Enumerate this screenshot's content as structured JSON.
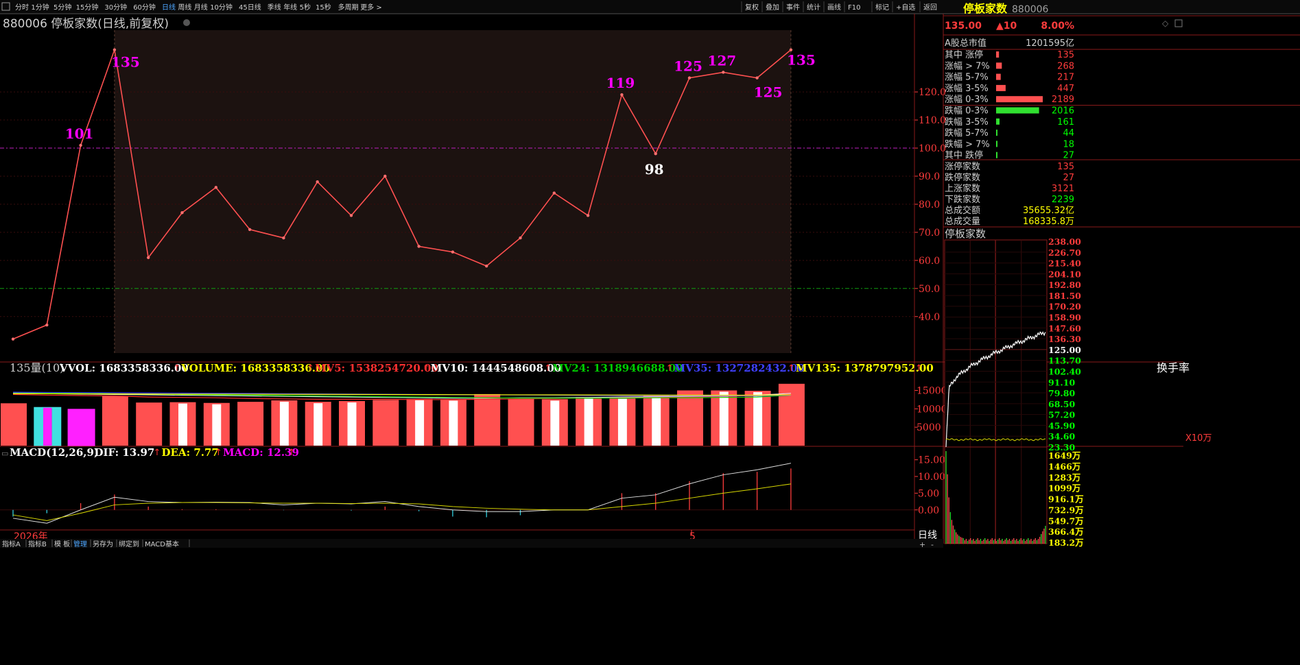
{
  "toolbar": {
    "periods": [
      "分时",
      "1分钟",
      "5分钟",
      "15分钟",
      "30分钟",
      "60分钟",
      "日线",
      "周线",
      "月线",
      "10分钟",
      "45日线",
      "季线",
      "年线",
      "5秒",
      "15秒",
      "多周期",
      "更多 >"
    ],
    "active_period": "日线",
    "right_buttons": [
      "复权",
      "叠加",
      "事件",
      "统计",
      "画线",
      "F10",
      "标记",
      "+自选",
      "返回"
    ]
  },
  "main_chart": {
    "title": "880006 停板家数(日线,前复权)",
    "y_ticks": [
      "120.0",
      "110.0",
      "100.0",
      "90.0",
      "80.0",
      "70.0",
      "60.0",
      "50.0",
      "40.0"
    ]
  },
  "chart_data": [
    {
      "type": "line",
      "name": "main",
      "values": [
        32,
        37,
        101,
        135,
        61,
        77,
        86,
        71,
        68,
        88,
        76,
        90,
        65,
        63,
        58,
        68,
        84,
        76,
        119,
        98,
        125,
        127,
        125,
        135
      ],
      "point_labels": [
        {
          "index": 2,
          "text": "101",
          "color": "#ff00ff"
        },
        {
          "index": 3,
          "text": "135",
          "color": "#ff00ff"
        },
        {
          "index": 18,
          "text": "119",
          "color": "#ff00ff"
        },
        {
          "index": 19,
          "text": "98",
          "color": "#ffffff"
        },
        {
          "index": 20,
          "text": "125",
          "color": "#ff00ff"
        },
        {
          "index": 21,
          "text": "127",
          "color": "#ff00ff"
        },
        {
          "index": 22,
          "text": "125",
          "color": "#ff00ff"
        },
        {
          "index": 23,
          "text": "135",
          "color": "#ff00ff"
        }
      ],
      "ylim": [
        27,
        142
      ],
      "ref_lines": [
        100,
        50
      ],
      "highlight_range": [
        3,
        23
      ],
      "line_color": "#ff5050"
    },
    {
      "type": "bar",
      "name": "volume",
      "values": [
        11500,
        10300,
        9800,
        13500,
        11700,
        11800,
        11600,
        11900,
        12300,
        11900,
        12100,
        12400,
        12700,
        12600,
        14000,
        12800,
        12600,
        13200,
        13100,
        13500,
        15000,
        15000,
        14900,
        16800
      ],
      "bar_styles": [
        "solid",
        "cyan",
        "magenta",
        "solid",
        "solid",
        "hollow",
        "hollow",
        "solid",
        "hollow",
        "hollow",
        "hollow",
        "solid",
        "hollow",
        "hollow",
        "solid",
        "solid",
        "hollow",
        "hollow",
        "hollow",
        "hollow",
        "solid",
        "hollow",
        "hollow",
        "solid"
      ],
      "ylim": [
        0,
        19000
      ],
      "y_ticks": [
        "15000",
        "10000",
        "5000"
      ],
      "unit": "X10万",
      "ma_series": [
        {
          "name": "MV5",
          "color": "#ff3030",
          "values": [
            13900,
            13700,
            13600,
            13500,
            13200,
            13100,
            13000,
            12800,
            12700,
            12600,
            12600,
            12600,
            12500,
            12500,
            12600,
            12700,
            12800,
            12900,
            13000,
            13100,
            13200,
            13400,
            13600,
            14000
          ]
        },
        {
          "name": "MV10",
          "color": "#e8e8e8",
          "values": [
            14200,
            14100,
            14000,
            13900,
            13800,
            13700,
            13600,
            13500,
            13400,
            13300,
            13200,
            13100,
            13000,
            12900,
            12900,
            13000,
            13000,
            13100,
            13200,
            13300,
            13400,
            13500,
            13700,
            14200
          ]
        },
        {
          "name": "MV24",
          "color": "#00cc00",
          "values": [
            14400,
            14300,
            14200,
            14100,
            14000,
            13900,
            13800,
            13700,
            13600,
            13500,
            13400,
            13300,
            13200,
            13100,
            13000,
            12900,
            12900,
            12900,
            12900,
            13000,
            13000,
            13100,
            13200,
            13700
          ]
        },
        {
          "name": "MV35",
          "color": "#4040ff",
          "values": [
            14500,
            14450,
            14400,
            14350,
            14300,
            14250,
            14200,
            14150,
            14100,
            14050,
            14000,
            13950,
            13900,
            13850,
            13800,
            13750,
            13700,
            13650,
            13600,
            13600,
            13600,
            13600,
            13600,
            13700
          ]
        },
        {
          "name": "MV135",
          "color": "#ffff00",
          "values": [
            14100,
            14080,
            14060,
            14040,
            14020,
            14000,
            13980,
            13960,
            13940,
            13920,
            13900,
            13880,
            13860,
            13840,
            13820,
            13800,
            13780,
            13760,
            13740,
            13720,
            13700,
            13700,
            13700,
            13800
          ]
        }
      ]
    },
    {
      "type": "line",
      "name": "macd",
      "dif": [
        -2.5,
        -4,
        0,
        3.8,
        2.5,
        2.2,
        2.3,
        2.2,
        1.5,
        2.0,
        1.8,
        2.5,
        1.0,
        0.0,
        -0.5,
        -0.5,
        0,
        0,
        3.5,
        4.5,
        7.8,
        10.5,
        12.0,
        13.97
      ],
      "dea": [
        -1.5,
        -3.2,
        -1.0,
        1.5,
        2.0,
        2.2,
        2.2,
        2.1,
        2.0,
        2.0,
        1.9,
        2.0,
        1.8,
        1.0,
        0.5,
        0.2,
        0,
        0,
        1.0,
        2.0,
        3.5,
        5.0,
        6.3,
        7.77
      ],
      "macd_bars": [
        -2.0,
        -1.0,
        2.0,
        4.6,
        1.0,
        0.2,
        0.2,
        0.2,
        -0.1,
        0,
        -0.2,
        1.0,
        -0.4,
        -2.0,
        -2.2,
        -1.6,
        0,
        0,
        5.0,
        5.0,
        8.6,
        11.0,
        11.4,
        12.39
      ],
      "ylim": [
        -6,
        18
      ],
      "y_ticks": [
        "15.00",
        "10.00",
        "5.00",
        "0.00"
      ]
    }
  ],
  "volume_panel": {
    "header": "135量(10)",
    "labels": [
      {
        "text": "VVOL: 1683358336.00",
        "color": "#ffffff"
      },
      {
        "text": "VOLUME: 1683358336.00",
        "color": "#ffff00"
      },
      {
        "text": "MV5: 1538254720.00",
        "color": "#ff3030"
      },
      {
        "text": "MV10: 1444548608.00",
        "color": "#ffffff"
      },
      {
        "text": "MV24: 1318946688.00",
        "color": "#00cc00"
      },
      {
        "text": "MV35: 1327282432.00",
        "color": "#4040ff"
      },
      {
        "text": "MV135: 1378797952.00",
        "color": "#ffff00"
      }
    ],
    "trailing": "换手率"
  },
  "macd_panel": {
    "labels": [
      {
        "text": "MACD(12,26,9)",
        "color": "#ffffff"
      },
      {
        "text": "DIF: 13.97",
        "color": "#ffffff"
      },
      {
        "text": "DEA: 7.77",
        "color": "#ffff00"
      },
      {
        "text": "MACD: 12.39",
        "color": "#ff00ff"
      }
    ]
  },
  "bottom_axis": {
    "year_label": "2026年",
    "month_label": "5",
    "period": "日线"
  },
  "bottom_tabs": [
    "指标A",
    "指标B",
    "模 板",
    "管理",
    "另存为",
    "绑定到",
    "MACD基本"
  ],
  "active_tab": "管理",
  "side_panel": {
    "title": "停板家数",
    "code": "880006",
    "price": "135.00",
    "change": "▲10",
    "change_pct": "8.00%",
    "market_cap_label": "A股总市值",
    "market_cap_value": "1201595亿",
    "dist_rows": [
      {
        "label": "其中 涨停",
        "value": "135",
        "kind": "up",
        "bar": 135
      },
      {
        "label": "涨幅 > 7%",
        "value": "268",
        "kind": "up",
        "bar": 268
      },
      {
        "label": "涨幅 5-7%",
        "value": "217",
        "kind": "up",
        "bar": 217
      },
      {
        "label": "涨幅 3-5%",
        "value": "447",
        "kind": "up",
        "bar": 447
      },
      {
        "label": "涨幅 0-3%",
        "value": "2189",
        "kind": "up",
        "bar": 2189
      },
      {
        "label": "跌幅 0-3%",
        "value": "2016",
        "kind": "down",
        "bar": 2016
      },
      {
        "label": "跌幅 3-5%",
        "value": "161",
        "kind": "down",
        "bar": 161
      },
      {
        "label": "跌幅 5-7%",
        "value": "44",
        "kind": "down",
        "bar": 44
      },
      {
        "label": "跌幅 > 7%",
        "value": "18",
        "kind": "down",
        "bar": 18
      },
      {
        "label": "其中 跌停",
        "value": "27",
        "kind": "down",
        "bar": 27
      }
    ],
    "stats_rows": [
      {
        "label": "涨停家数",
        "value": "135",
        "color": "#ff3c3c"
      },
      {
        "label": "跌停家数",
        "value": "27",
        "color": "#ff3c3c"
      },
      {
        "label": "上涨家数",
        "value": "3121",
        "color": "#ff3c3c"
      },
      {
        "label": "下跌家数",
        "value": "2239",
        "color": "#00ff00"
      },
      {
        "label": "总成交额",
        "value": "35655.32亿",
        "color": "#ffff00"
      },
      {
        "label": "总成交量",
        "value": "168335.8万",
        "color": "#ffff00"
      }
    ],
    "mini_title": "停板家数",
    "mini_price_ticks": [
      {
        "text": "238.00",
        "color": "#ff3c3c"
      },
      {
        "text": "226.70",
        "color": "#ff3c3c"
      },
      {
        "text": "215.40",
        "color": "#ff3c3c"
      },
      {
        "text": "204.10",
        "color": "#ff3c3c"
      },
      {
        "text": "192.80",
        "color": "#ff3c3c"
      },
      {
        "text": "181.50",
        "color": "#ff3c3c"
      },
      {
        "text": "170.20",
        "color": "#ff3c3c"
      },
      {
        "text": "158.90",
        "color": "#ff3c3c"
      },
      {
        "text": "147.60",
        "color": "#ff3c3c"
      },
      {
        "text": "136.30",
        "color": "#ff3c3c"
      },
      {
        "text": "125.00",
        "color": "#ffffff"
      },
      {
        "text": "113.70",
        "color": "#00ff00"
      },
      {
        "text": "102.40",
        "color": "#00ff00"
      },
      {
        "text": "91.10",
        "color": "#00ff00"
      },
      {
        "text": "79.80",
        "color": "#00ff00"
      },
      {
        "text": "68.50",
        "color": "#00ff00"
      },
      {
        "text": "57.20",
        "color": "#00ff00"
      },
      {
        "text": "45.90",
        "color": "#00ff00"
      },
      {
        "text": "34.60",
        "color": "#00ff00"
      },
      {
        "text": "23.30",
        "color": "#00ff00"
      }
    ],
    "mini_vol_ticks": [
      "1649万",
      "1466万",
      "1283万",
      "1099万",
      "916.1万",
      "732.9万",
      "549.7万",
      "366.4万",
      "183.2万"
    ]
  }
}
